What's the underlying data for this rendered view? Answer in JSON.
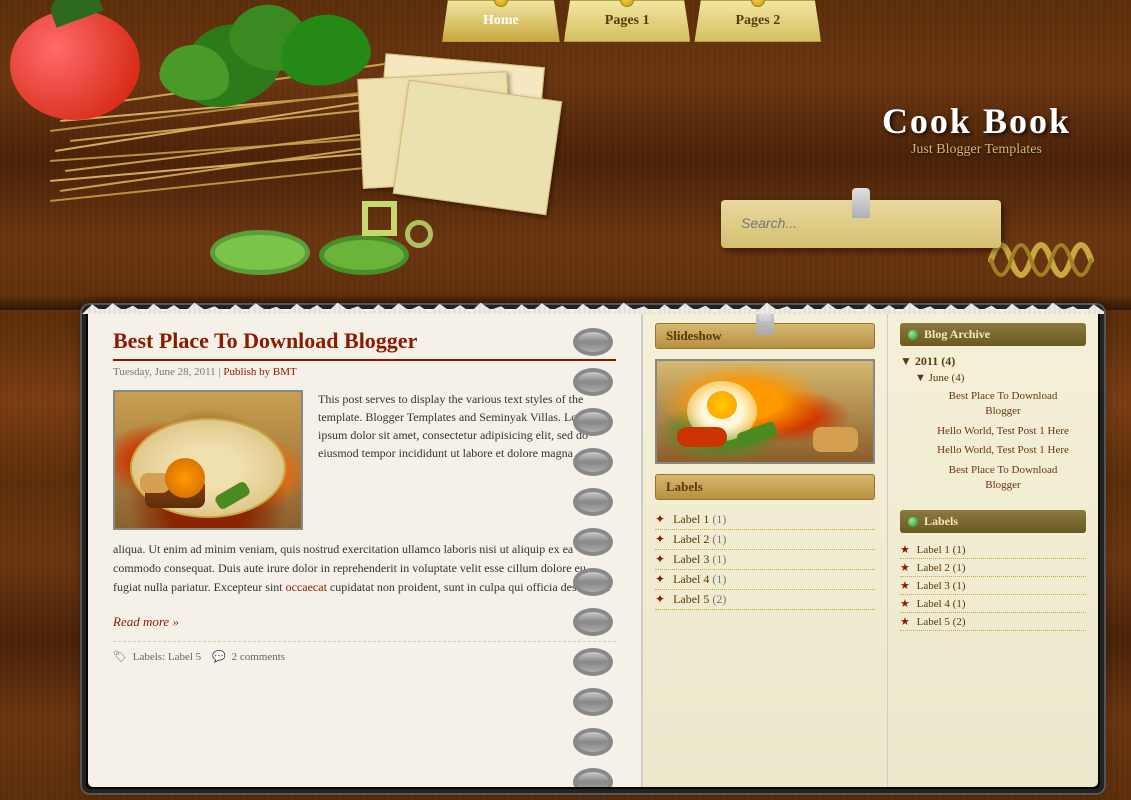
{
  "site": {
    "title": "Cook Book",
    "subtitle": "Just Blogger Templates"
  },
  "nav": {
    "items": [
      {
        "label": "Home",
        "active": true
      },
      {
        "label": "Pages 1",
        "active": false
      },
      {
        "label": "Pages 2",
        "active": false
      }
    ]
  },
  "search": {
    "placeholder": "Search..."
  },
  "post": {
    "title": "Best Place To Download Blogger",
    "meta_date": "Tuesday, June 28, 2011",
    "meta_sep": " | ",
    "meta_publish": "Publish by BMT",
    "body_part1": "This post serves to display the various text styles of the template. Blogger Templates and Seminyak Villas. Lorem ipsum dolor sit amet, consectetur adipisicing elit, sed do eiusmod tempor incididunt ut labore et dolore magna",
    "body_part2": "aliqua. Ut enim ad minim veniam, quis nostrud exercitation ullamco laboris nisi ut aliquip ex ea commodo consequat. Duis aute irure dolor in reprehenderit in voluptate velit esse cillum dolore eu fugiat nulla pariatur. Excepteur sint",
    "body_link": "occaecat",
    "body_part3": "cupidatat non proident, sunt in culpa qui officia deserunt...",
    "read_more": "Read more »",
    "footer_label": "Labels: Label 5",
    "footer_comments": "2 comments"
  },
  "sidebar_middle": {
    "slideshow_title": "Slideshow",
    "labels_title": "Labels",
    "labels": [
      {
        "name": "Label 1",
        "count": "(1)"
      },
      {
        "name": "Label 2",
        "count": "(1)"
      },
      {
        "name": "Label 3",
        "count": "(1)"
      },
      {
        "name": "Label 4",
        "count": "(1)"
      },
      {
        "name": "Label 5",
        "count": "(2)"
      }
    ]
  },
  "sidebar_right": {
    "blog_archive_title": "Blog Archive",
    "archive": {
      "year": "2011 (4)",
      "month": "June (4)",
      "links": [
        "Best Place To Download Blogger",
        "Hello World, Test Post 1 Here",
        "Hello World, Test Post 1 Here",
        "Best Place To Download Blogger"
      ]
    },
    "labels_title": "Labels",
    "labels": [
      {
        "name": "Label 1",
        "count": "(1)"
      },
      {
        "name": "Label 2",
        "count": "(1)"
      },
      {
        "name": "Label 3",
        "count": "(1)"
      },
      {
        "name": "Label 4",
        "count": "(1)"
      },
      {
        "name": "Label 5",
        "count": "(2)"
      }
    ]
  },
  "icons": {
    "archive_dot": "●",
    "label_bullet": "✦",
    "list_bullet": "✦",
    "nav_pin": "📌",
    "tag_icon": "🏷",
    "comment_icon": "💬",
    "triangle_down": "▼"
  }
}
